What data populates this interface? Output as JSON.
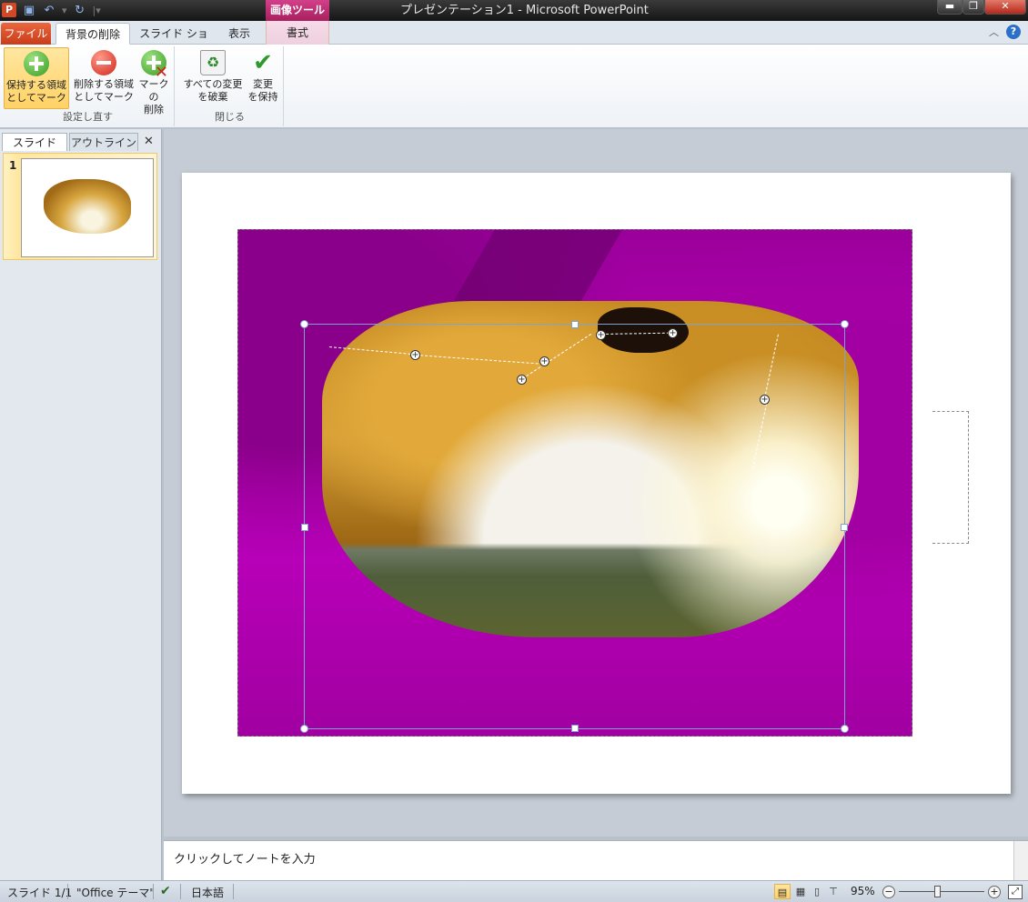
{
  "window": {
    "title": "プレゼンテーション1 - Microsoft PowerPoint",
    "context_tab_header": "画像ツール",
    "app_logo": "P"
  },
  "quick_access": {
    "icons": [
      "save-icon",
      "undo-icon",
      "redo-icon",
      "customize-icon"
    ]
  },
  "tabs": {
    "file": "ファイル",
    "active": "背景の削除",
    "slideshow": "スライド ショー",
    "view": "表示",
    "format": "書式"
  },
  "ribbon": {
    "group1": {
      "label": "設定し直す",
      "mark_keep": "保持する領域としてマーク",
      "mark_keep_lines": [
        "保持する領域",
        "としてマーク"
      ],
      "mark_remove_lines": [
        "削除する領域",
        "としてマーク"
      ],
      "delete_mark_lines": [
        "マークの",
        "削除"
      ]
    },
    "group2": {
      "label": "閉じる",
      "discard_lines": [
        "すべての変更",
        "を破棄"
      ],
      "keep_lines": [
        "変更",
        "を保持"
      ]
    }
  },
  "left_pane": {
    "tab_slides": "スライド",
    "tab_outline": "アウトライン",
    "close": "✕",
    "slide_number": "1"
  },
  "notes": {
    "placeholder": "クリックしてノートを入力"
  },
  "status": {
    "slide_info": "スライド 1/1",
    "theme": "\"Office テーマ\"",
    "language": "日本語",
    "zoom": "95%",
    "zoom_fraction": 0.45
  },
  "colors": {
    "removal_overlay": "#b000b0",
    "file_tab": "#d24726",
    "selection_highlight": "#ffd265"
  }
}
